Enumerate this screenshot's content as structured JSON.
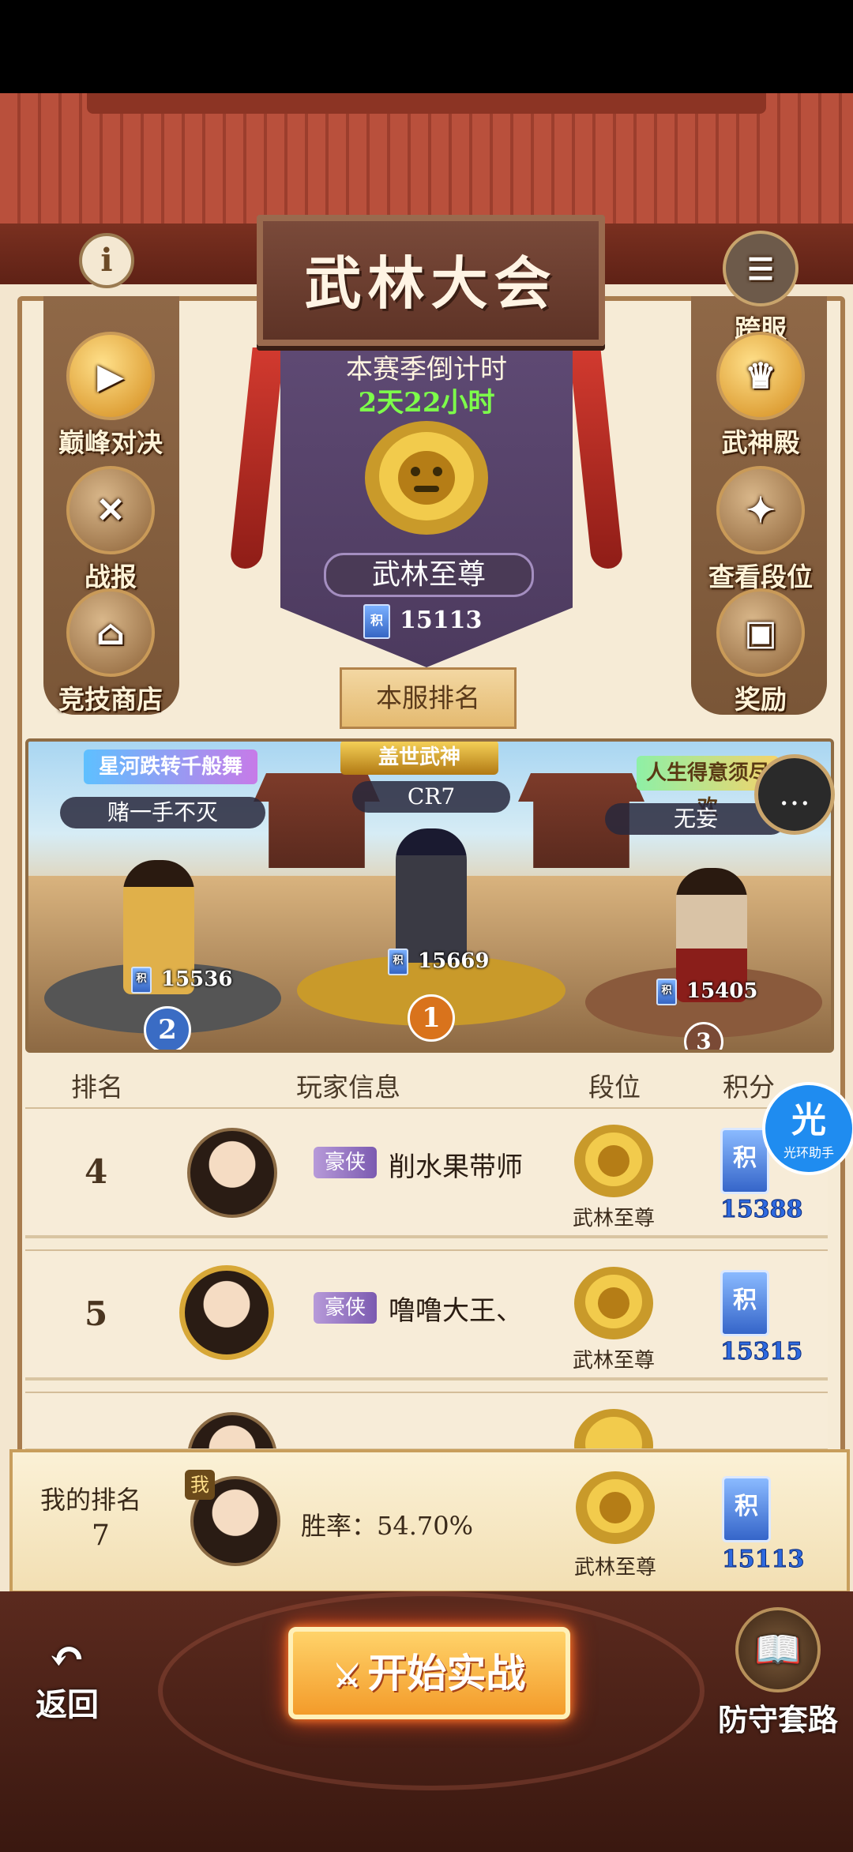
{
  "header": {
    "title": "武林大会",
    "info_icon": "i"
  },
  "left_menu": [
    {
      "label": "巅峰对决",
      "icon": "play-icon"
    },
    {
      "label": "战报",
      "icon": "scroll-icon"
    },
    {
      "label": "竞技商店",
      "icon": "shop-icon"
    }
  ],
  "right_menu": [
    {
      "label": "跨服",
      "icon": "list-icon"
    },
    {
      "label": "武神殿",
      "icon": "shrine-icon"
    },
    {
      "label": "查看段位",
      "icon": "dragon-icon"
    },
    {
      "label": "奖励",
      "icon": "chest-icon"
    }
  ],
  "season": {
    "countdown_label": "本赛季倒计时",
    "countdown_value": "2天22小时",
    "rank_name": "武林至尊",
    "score": "15113",
    "token_char": "积"
  },
  "server_rank_button": "本服排名",
  "podium": {
    "center_title": "盖世武神",
    "left_title": "星河跌转千般舞",
    "right_title": "人生得意须尽欢",
    "players": [
      {
        "rank": "1",
        "name": "CR7",
        "score": "15669"
      },
      {
        "rank": "2",
        "name": "赌一手不灭",
        "score": "15536"
      },
      {
        "rank": "3",
        "name": "无妄",
        "score": "15405"
      }
    ]
  },
  "table": {
    "headers": {
      "rank": "排名",
      "info": "玩家信息",
      "tier": "段位",
      "points": "积分"
    },
    "rows": [
      {
        "rank": "4",
        "tag": "豪侠",
        "name": "削水果带师",
        "tier": "武林至尊",
        "points": "15388"
      },
      {
        "rank": "5",
        "tag": "豪侠",
        "name": "噜噜大王、",
        "tier": "武林至尊",
        "points": "15315"
      }
    ]
  },
  "my_rank": {
    "label": "我的排名",
    "value": "7",
    "me_badge": "我",
    "winrate_label": "胜率：",
    "winrate": "54.70%",
    "tier": "武林至尊",
    "points": "15113"
  },
  "helper": {
    "label": "光环助手",
    "glyph": "光"
  },
  "bottom": {
    "back": "返回",
    "fight_part1": "开始",
    "fight_part2": "实战",
    "defense": "防守套路"
  },
  "colors": {
    "accent": "#f39b2a",
    "countdown": "#7dff4a",
    "points": "#2e6ae0"
  }
}
